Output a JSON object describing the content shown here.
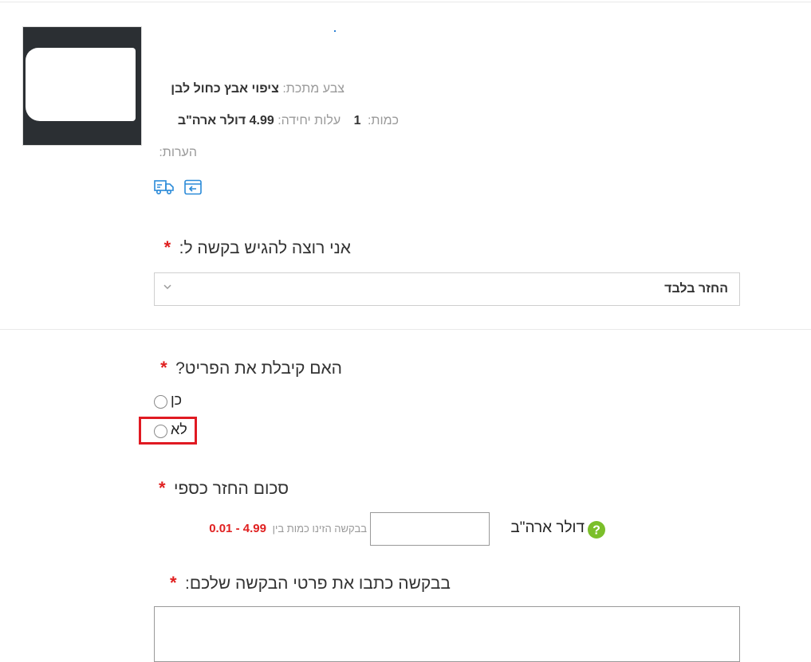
{
  "colors": {
    "required": "#e02020",
    "link_icon": "#2a8ad8",
    "help_green": "#7bbf2a",
    "highlight": "#e01a22"
  },
  "product": {
    "image_alt": "product-thumbnail",
    "color_label": "צבע מתכת:",
    "color_value": "ציפוי אבץ כחול לבן",
    "quantity_label": "כמות:",
    "quantity_value": "1",
    "unit_cost_label": "עלות יחידה:",
    "unit_cost_value": "4.99 דולר ארה\"ב",
    "notes_label": "הערות:",
    "icons": [
      "shipping-truck-icon",
      "return-box-icon"
    ]
  },
  "request_type": {
    "required_mark": "*",
    "label": "אני רוצה להגיש בקשה ל:",
    "selected": "החזר בלבד"
  },
  "received": {
    "required_mark": "*",
    "question": "האם קיבלת את הפריט?",
    "options": [
      {
        "label": "כן",
        "selected": false
      },
      {
        "label": "לא",
        "selected": false
      }
    ]
  },
  "refund": {
    "required_mark": "*",
    "label": "סכום החזר כספי",
    "currency": "דולר ארה\"ב",
    "amount_value": "",
    "hint": "בבקשה הזינו כמות בין",
    "range": "4.99 - 0.01"
  },
  "details": {
    "required_mark": "*",
    "label": "בבקשה כתבו את פרטי הבקשה שלכם:",
    "value": ""
  }
}
